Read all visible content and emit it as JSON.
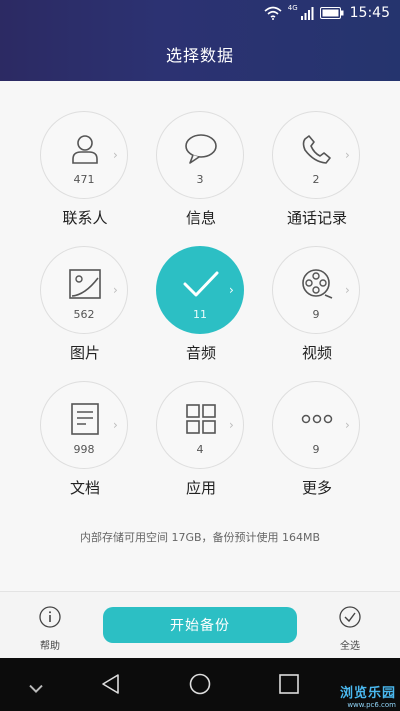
{
  "status_bar": {
    "time": "15:45",
    "network_label": "4G"
  },
  "header": {
    "title": "选择数据"
  },
  "grid": [
    {
      "name": "contacts",
      "label": "联系人",
      "count": "471",
      "icon": "person-icon",
      "selected": false
    },
    {
      "name": "messages",
      "label": "信息",
      "count": "3",
      "icon": "chat-bubble-icon",
      "selected": false
    },
    {
      "name": "call-log",
      "label": "通话记录",
      "count": "2",
      "icon": "phone-icon",
      "selected": false
    },
    {
      "name": "pictures",
      "label": "图片",
      "count": "562",
      "icon": "image-icon",
      "selected": false
    },
    {
      "name": "audio",
      "label": "音频",
      "count": "11",
      "icon": "checkmark-icon",
      "selected": true
    },
    {
      "name": "video",
      "label": "视频",
      "count": "9",
      "icon": "film-reel-icon",
      "selected": false
    },
    {
      "name": "documents",
      "label": "文档",
      "count": "998",
      "icon": "document-icon",
      "selected": false
    },
    {
      "name": "apps",
      "label": "应用",
      "count": "4",
      "icon": "app-grid-icon",
      "selected": false
    },
    {
      "name": "more",
      "label": "更多",
      "count": "9",
      "icon": "more-dots-icon",
      "selected": false
    }
  ],
  "storage_note": "内部存储可用空间 17GB，备份预计使用 164MB",
  "bottom_bar": {
    "help_label": "帮助",
    "start_label": "开始备份",
    "select_all_label": "全选"
  },
  "watermark": {
    "title": "浏览乐园",
    "url": "www.pc6.com"
  },
  "colors": {
    "accent": "#2cbfc4",
    "header": "#2c2a63",
    "navbar": "#0c0c0c"
  }
}
